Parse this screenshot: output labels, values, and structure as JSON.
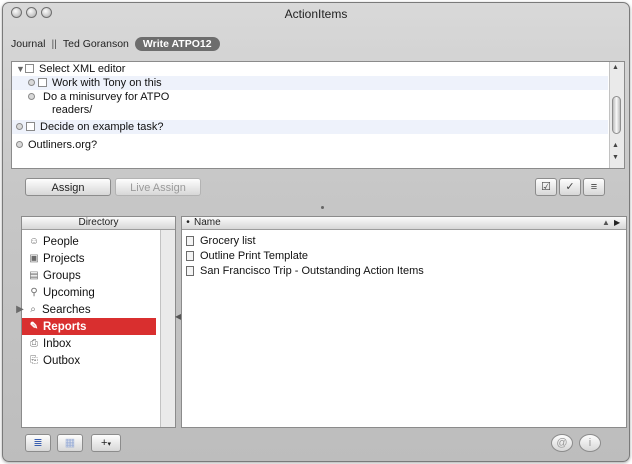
{
  "window": {
    "title": "ActionItems"
  },
  "breadcrumb": {
    "journal": "Journal",
    "separator": "||",
    "person": "Ted Goranson",
    "active": "Write ATPO12"
  },
  "outline": {
    "rows": [
      {
        "text": "Select XML editor"
      },
      {
        "text": "Work with Tony on this"
      },
      {
        "text": "Do a minisurvey for ATPO"
      },
      {
        "text": "readers/"
      },
      {
        "text": "Decide on example task?"
      },
      {
        "text": "Outliners.org?"
      }
    ]
  },
  "toolbar": {
    "assign_label": "Assign",
    "live_assign_label": "Live Assign"
  },
  "directory": {
    "header": "Directory",
    "items": [
      {
        "label": "People",
        "icon": "people-icon"
      },
      {
        "label": "Projects",
        "icon": "projects-icon"
      },
      {
        "label": "Groups",
        "icon": "groups-icon"
      },
      {
        "label": "Upcoming",
        "icon": "upcoming-icon"
      },
      {
        "label": "Searches",
        "icon": "search-icon"
      },
      {
        "label": "Reports",
        "icon": "reports-icon",
        "selected": true
      },
      {
        "label": "Inbox",
        "icon": "inbox-icon"
      },
      {
        "label": "Outbox",
        "icon": "outbox-icon"
      }
    ]
  },
  "files": {
    "column_name": "Name",
    "rows": [
      {
        "name": "Grocery list"
      },
      {
        "name": "Outline Print Template"
      },
      {
        "name": "San Francisco Trip - Outstanding Action Items"
      }
    ]
  },
  "colors": {
    "selection": "#d92f2f",
    "row_alt": "#eef2fb"
  }
}
